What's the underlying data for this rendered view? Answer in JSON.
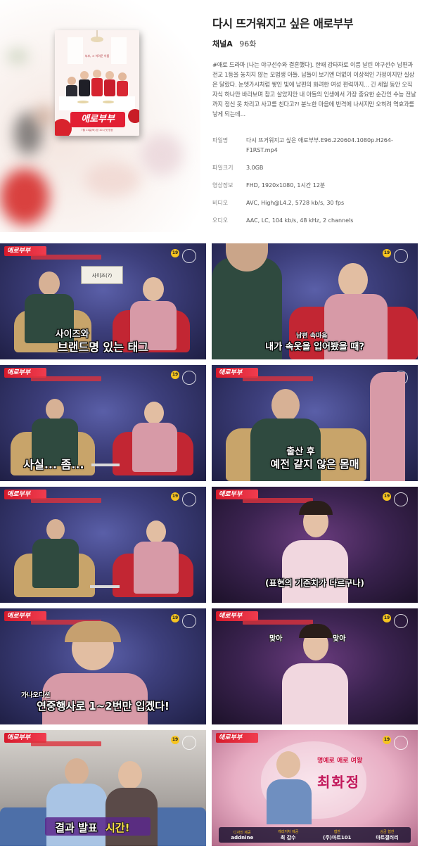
{
  "program": {
    "title": "다시 뜨거워지고 싶은 애로부부",
    "channel": "채널A",
    "episode": "96화",
    "description": "#애로 드라마 [나는 야구선수와 결혼했다]. 한때 강타자로 이름 날린 야구선수 남편과 전교 1등을 놓치지 않는 모범생 아들. 남들이 보기엔 더없이 이상적인 가정이지만 실상은 달랐다. 눈엣가시처럼 쌓인 빛에 남편의 화려한 여성 편력까지... 긴 세월 동안 오직 자식 하나만 바라보며 참고 살았지만 내 아들의 인생에서 가장 중요한 순간인 수능 전날까지 정신 못 차리고 사고를 친다고?! 분노한 마음에 반격에 나서지만 오히려 역효과를 낳게 되는데..."
  },
  "poster": {
    "logo_text": "애로부부",
    "tagline": "부부, 그 어려운 이름",
    "date_text": "7월 11일(토) 밤 10시 첫 방송"
  },
  "file_info": [
    {
      "key": "파일명",
      "value": "다시 뜨거워지고 싶은 애로부부.E96.220604.1080p.H264-F1RST.mp4"
    },
    {
      "key": "파일크기",
      "value": "3.0GB"
    },
    {
      "key": "영상정보",
      "value": "FHD, 1920x1080, 1시간 12분"
    },
    {
      "key": "비디오",
      "value": "AVC, High@L4.2, 5728 kb/s, 30 fps"
    },
    {
      "key": "오디오",
      "value": "AAC, LC, 104 kb/s, 48 kHz, 2 channels"
    }
  ],
  "thumbs": {
    "logo": "애로부부",
    "age_rating": "19",
    "t1": {
      "sign": "사이즈(?)",
      "caption_line1": "사이즈와",
      "caption_line2": "브랜드명 있는 태그"
    },
    "t2": {
      "small": "남편 속마음",
      "caption": "내가 속옷을 입어봤을 때?"
    },
    "t3": {
      "caption": "사실... 좀..."
    },
    "t4": {
      "caption_line1": "출산 후",
      "caption_line2": "예전 같지 않은 몸매"
    },
    "t6": {
      "caption": "(표현의 기준치가 다르구나)"
    },
    "t7": {
      "small": "가나오디션",
      "caption": "연중행사로 1~2번만 입겠다!"
    },
    "t8": {
      "left": "맞아",
      "right": "맞아"
    },
    "t9": {
      "caption_white": "결과 발표",
      "caption_yellow": "시간!"
    },
    "t10": {
      "subtitle": "명예로 애로 여왕",
      "name": "최화정",
      "sponsors": [
        {
          "label": "디자인 제공",
          "value": "addnine"
        },
        {
          "label": "캐리커처 제공",
          "value": "최 갑수"
        },
        {
          "label": "협찬",
          "value": "(주)마트101"
        },
        {
          "label": "상금 협찬",
          "value": "마트갤러리"
        }
      ]
    }
  }
}
